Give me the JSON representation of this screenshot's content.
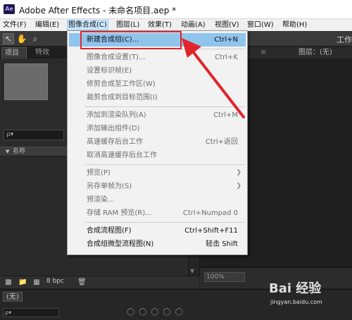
{
  "window": {
    "logo_text": "Ae",
    "title": "Adobe After Effects - 未命名项目.aep *"
  },
  "menubar": {
    "items": [
      {
        "label": "文件(F)"
      },
      {
        "label": "编辑(E)"
      },
      {
        "label": "图像合成(C)",
        "active": true
      },
      {
        "label": "图层(L)"
      },
      {
        "label": "效果(T)"
      },
      {
        "label": "动画(A)"
      },
      {
        "label": "视图(V)"
      },
      {
        "label": "窗口(W)"
      },
      {
        "label": "帮助(H)"
      }
    ]
  },
  "toolbar": {
    "tools": [
      "selection-tool",
      "hand-tool",
      "zoom-tool"
    ],
    "workspace_label": "工作"
  },
  "project_panel": {
    "tab_project": "项目",
    "tab_effects": "特效",
    "search_placeholder": "ρ▾",
    "column_name": "名称",
    "bpc": "8 bpc"
  },
  "right_panel": {
    "layer_tab": "图层：(无)",
    "zoom_value": "100%"
  },
  "timeline": {
    "tab": "(无)"
  },
  "dropdown": {
    "items": [
      {
        "label": "新建合成组(C)...",
        "shortcut": "Ctrl+N",
        "state": "highlighted"
      },
      {
        "sep": true
      },
      {
        "label": "图像合成设置(T)...",
        "shortcut": "Ctrl+K",
        "state": "disabled"
      },
      {
        "label": "设置标识帧(E)",
        "shortcut": "",
        "state": "disabled"
      },
      {
        "label": "修剪合成至工作区(W)",
        "shortcut": "",
        "state": "disabled"
      },
      {
        "label": "裁剪合成到目标范围(I)",
        "shortcut": "",
        "state": "disabled"
      },
      {
        "sep": true
      },
      {
        "label": "添加到渲染队列(A)",
        "shortcut": "Ctrl+M",
        "state": "disabled"
      },
      {
        "label": "添加输出组件(D)",
        "shortcut": "",
        "state": "disabled"
      },
      {
        "label": "高速缓存后台工作",
        "shortcut": "Ctrl+返回",
        "state": "disabled"
      },
      {
        "label": "取消高速缓存后台工作",
        "shortcut": "",
        "state": "disabled"
      },
      {
        "sep": true
      },
      {
        "label": "预览(P)",
        "shortcut": "",
        "state": "disabled",
        "submenu": true
      },
      {
        "label": "另存单帧为(S)",
        "shortcut": "",
        "state": "disabled",
        "submenu": true
      },
      {
        "label": "预渲染...",
        "shortcut": "",
        "state": "disabled"
      },
      {
        "label": "存储 RAM 预览(R)...",
        "shortcut": "Ctrl+Numpad 0",
        "state": "disabled"
      },
      {
        "sep": true
      },
      {
        "label": "合成流程图(F)",
        "shortcut": "Ctrl+Shift+F11",
        "state": "enabled"
      },
      {
        "label": "合成组微型流程图(N)",
        "shortcut": "轻击 Shift",
        "state": "enabled"
      }
    ]
  },
  "watermark": {
    "logo": "Bai 经验",
    "url": "jingyan.baidu.com"
  },
  "colors": {
    "highlight": "#8fc4ed",
    "annotation_red": "#e0252b",
    "dark_ui": "#2b2b2b"
  }
}
